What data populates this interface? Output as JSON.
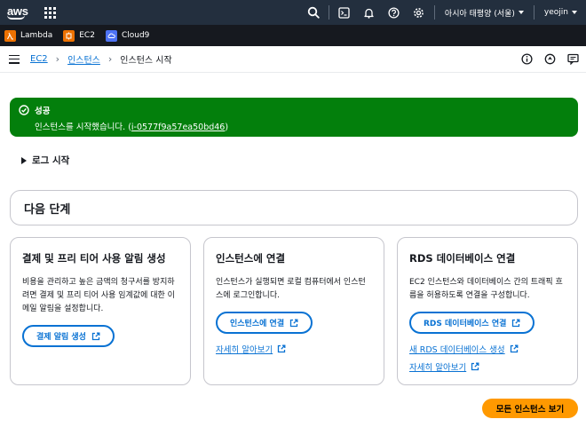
{
  "topnav": {
    "logo_text": "aws",
    "region_label": "아시아 태평양 (서울)",
    "user_label": "yeojin"
  },
  "favorites": [
    {
      "label": "Lambda",
      "icon": "lambda-icon",
      "color": "#ed7100"
    },
    {
      "label": "EC2",
      "icon": "ec2-icon",
      "color": "#ed7100"
    },
    {
      "label": "Cloud9",
      "icon": "cloud9-icon",
      "color": "#4d72f3"
    }
  ],
  "breadcrumb": {
    "root": "EC2",
    "parent": "인스턴스",
    "current": "인스턴스 시작"
  },
  "flash": {
    "title": "성공",
    "message_prefix": "인스턴스를 시작했습니다. (",
    "instance_id": "i-0577f9a57ea50bd46",
    "message_suffix": ")",
    "color": "#037f0c"
  },
  "log_toggle": "로그 시작",
  "next_steps": {
    "title": "다음 단계",
    "cards": [
      {
        "title": "결제 및 프리 티어 사용 알림 생성",
        "description": "비용을 관리하고 높은 금액의 청구서를 방지하려면 결제 및 프리 티어 사용 임계값에 대한 이메일 알림을 설정합니다.",
        "button": "결제 알림 생성"
      },
      {
        "title": "인스턴스에 연결",
        "description": "인스턴스가 실행되면 로컬 컴퓨터에서 인스턴스에 로그인합니다.",
        "button": "인스턴스에 연결",
        "link1": "자세히 알아보기"
      },
      {
        "title": "RDS 데이터베이스 연결",
        "description": "EC2 인스턴스와 데이터베이스 간의 트래픽 흐름을 허용하도록 연결을 구성합니다.",
        "button": "RDS 데이터베이스 연결",
        "link1": "새 RDS 데이터베이스 생성",
        "link2": "자세히 알아보기"
      }
    ]
  },
  "primary_button": "모든 인스턴스 보기",
  "colors": {
    "accent": "#0972d3",
    "primary": "#ff9900",
    "nav": "#232f3e"
  }
}
